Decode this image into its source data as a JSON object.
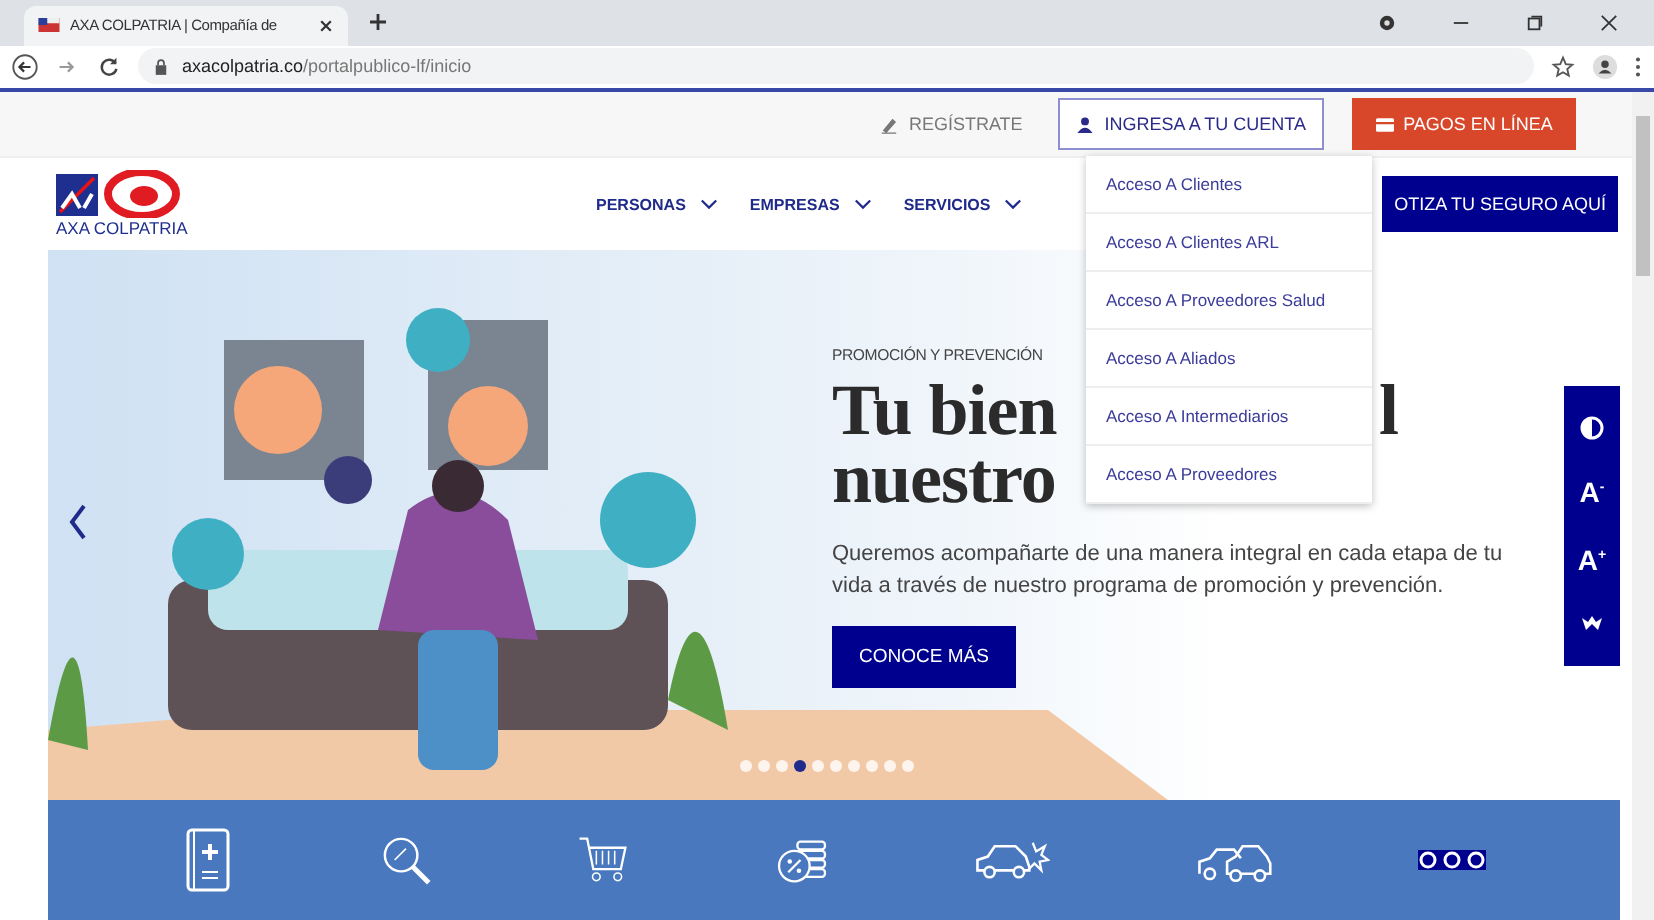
{
  "browser": {
    "tab_title": "AXA COLPATRIA | Compañía de",
    "url_host": "axacolpatria.co",
    "url_path": "/portalpublico-lf/inicio"
  },
  "top_bar": {
    "register": "REGÍSTRATE",
    "login": "INGRESA A TU CUENTA",
    "payments": "PAGOS EN LÍNEA"
  },
  "logo": {
    "text": "AXA COLPATRIA"
  },
  "nav": [
    {
      "label": "PERSONAS"
    },
    {
      "label": "EMPRESAS"
    },
    {
      "label": "SERVICIOS"
    }
  ],
  "quote_button": "OTIZA TU SEGURO AQUÍ",
  "login_menu": [
    "Acceso A Clientes",
    "Acceso A Clientes ARL",
    "Acceso A Proveedores Salud",
    "Acceso A Aliados",
    "Acceso A Intermediarios",
    "Acceso A Proveedores"
  ],
  "hero": {
    "kicker": "PROMOCIÓN Y PREVENCIÓN",
    "heading_line_1": "Tu bien",
    "heading_line_1_end": "l",
    "heading_line_2": "nuestro",
    "text": "Queremos acompañarte de una manera integral en cada etapa de tu vida a través de nuestro programa de promoción y prevención.",
    "button": "CONOCE MÁS",
    "dots": [
      {
        "selected": false
      },
      {
        "selected": false
      },
      {
        "selected": false
      },
      {
        "selected": true
      },
      {
        "selected": false
      },
      {
        "selected": false
      },
      {
        "selected": false
      },
      {
        "selected": false
      },
      {
        "selected": false
      },
      {
        "selected": false
      }
    ]
  },
  "accessibility": [
    "A$^{-}$",
    "A$^{+}$"
  ],
  "services": [
    {
      "kind": "book"
    },
    {
      "kind": "search"
    },
    {
      "kind": "cart"
    },
    {
      "kind": "coins"
    },
    {
      "kind": "crash"
    },
    {
      "kind": "cars"
    },
    {
      "kind": "more"
    }
  ]
}
